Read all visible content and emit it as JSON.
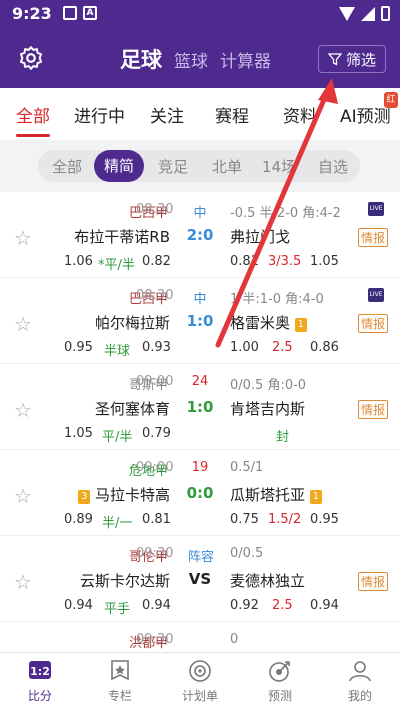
{
  "status_bar": {
    "time": "9:23"
  },
  "header": {
    "nav": [
      "足球",
      "篮球",
      "计算器"
    ],
    "filter_label": "筛选"
  },
  "tabs": [
    "全部",
    "进行中",
    "关注",
    "赛程",
    "资料",
    "AI预测"
  ],
  "tab_badge": "红",
  "chips": [
    "全部",
    "精简",
    "竞足",
    "北单",
    "14场",
    "自选"
  ],
  "matches": [
    {
      "league": "巴西甲",
      "league_color": "#b03a3a",
      "time": "08:30",
      "status": "中",
      "status_color": "#3a8bd8",
      "info": "-0.5  半:2-0  角:4-2",
      "home": "布拉干蒂诺RB",
      "score": "2:0",
      "score_color": "#3a8bd8",
      "away": "弗拉门戈",
      "o1": "1.06",
      "oh": "*平/半",
      "oh_color": "#2e9b3c",
      "o2": "0.82",
      "r1": "0.81",
      "rh": "3/3.5",
      "r2": "1.05",
      "info_badge": "情报",
      "live": true
    },
    {
      "league": "巴西甲",
      "league_color": "#b03a3a",
      "time": "08:30",
      "status": "中",
      "status_color": "#3a8bd8",
      "info": "1   半:1-0  角:4-0",
      "home": "帕尔梅拉斯",
      "score": "1:0",
      "score_color": "#3a8bd8",
      "away": "格雷米奥",
      "away_rank": "1",
      "o1": "0.95",
      "oh": "半球",
      "oh_color": "#2e9b3c",
      "o2": "0.93",
      "r1": "1.00",
      "rh": "2.5",
      "r2": "0.86",
      "info_badge": "情报",
      "live": true
    },
    {
      "league": "哥斯甲",
      "league_color": "#888888",
      "time": "09:00",
      "status": "24",
      "status_color": "#d8262b",
      "info": "0/0.5   角:0-0",
      "home": "圣何塞体育",
      "score": "1:0",
      "score_color": "#2e9b3c",
      "away": "肯塔吉内斯",
      "o1": "1.05",
      "oh": "平/半",
      "oh_color": "#2e9b3c",
      "o2": "0.79",
      "r_note": "封",
      "info_badge": "情报"
    },
    {
      "league": "危地甲",
      "league_color": "#2e9b3c",
      "time": "09:00",
      "status": "19",
      "status_color": "#d8262b",
      "info": "0.5/1",
      "home": "马拉卡特高",
      "home_rank": "3",
      "score": "0:0",
      "score_color": "#2e9b3c",
      "away": "瓜斯塔托亚",
      "away_rank": "1",
      "o1": "0.89",
      "oh": "半/一",
      "oh_color": "#2e9b3c",
      "o2": "0.81",
      "r1": "0.75",
      "rh": "1.5/2",
      "r2": "0.95"
    },
    {
      "league": "哥伦甲",
      "league_color": "#b03a3a",
      "time": "09:30",
      "status": "阵容",
      "status_color": "#3a8bd8",
      "info": "0/0.5",
      "home": "云斯卡尔达斯",
      "score": "VS",
      "score_color": "#222222",
      "away": "麦德林独立",
      "o1": "0.94",
      "oh": "平手",
      "oh_color": "#2e9b3c",
      "o2": "0.94",
      "r1": "0.92",
      "rh": "2.5",
      "r2": "0.94",
      "info_badge": "情报"
    },
    {
      "league": "洪都甲",
      "league_color": "#b03a3a",
      "time": "09:30",
      "info": "0"
    }
  ],
  "bottom_nav": [
    "比分",
    "专栏",
    "计划单",
    "预测",
    "我的"
  ],
  "colors": {
    "brand": "#4e2a8f",
    "accent": "#d8262b"
  }
}
